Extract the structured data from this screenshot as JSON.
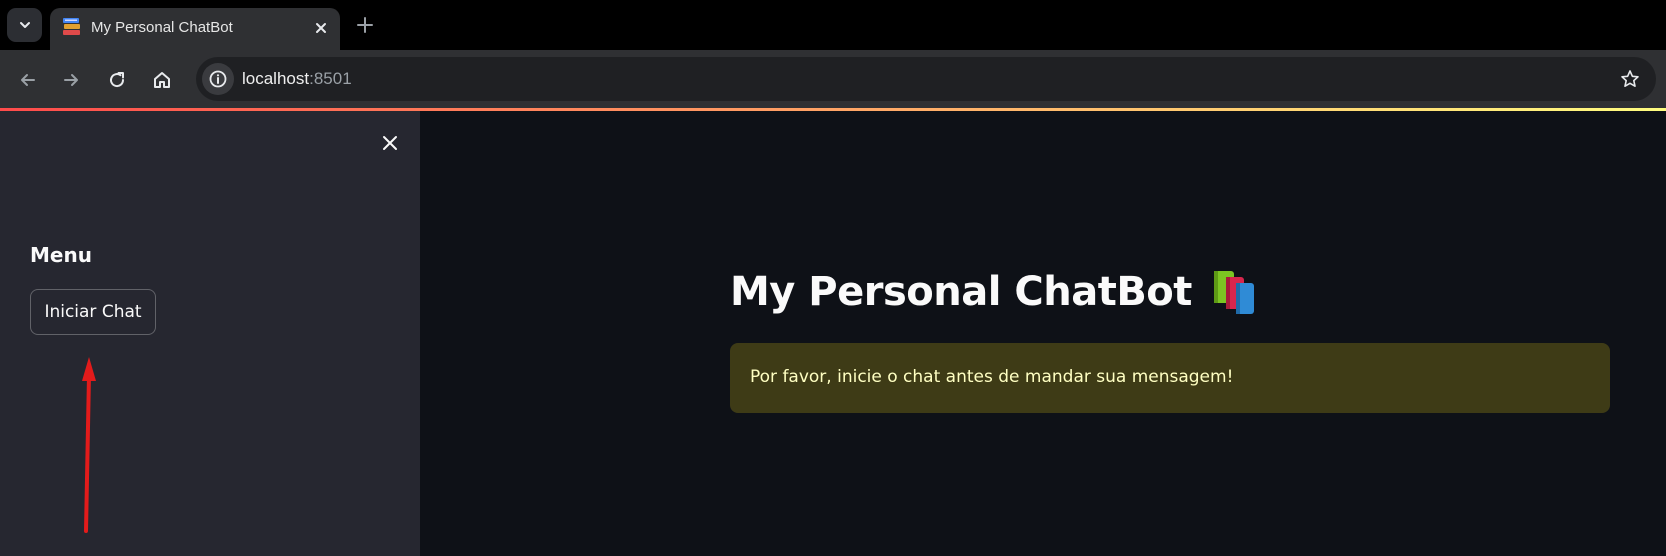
{
  "browser": {
    "tab_title": "My Personal ChatBot",
    "url_host": "localhost",
    "url_port": ":8501",
    "icons": {
      "tab_search": "chevron-down-icon",
      "favicon": "books-icon",
      "tab_close": "close-icon",
      "new_tab": "plus-icon",
      "back": "arrow-left-icon",
      "forward": "arrow-right-icon",
      "reload": "reload-icon",
      "home": "home-icon",
      "site_info": "info-icon",
      "bookmark": "star-icon"
    }
  },
  "sidebar": {
    "heading": "Menu",
    "start_button_label": "Iniciar Chat",
    "close_icon": "close-icon",
    "annotation": "red-arrow"
  },
  "main": {
    "title": "My Personal ChatBot",
    "title_icon": "books-emoji",
    "alert_message": "Por favor, inicie o chat antes de mandar sua mensagem!"
  },
  "colors": {
    "background": "#0e1117",
    "sidebar_background": "#262730",
    "text": "#fafafa",
    "alert_background": "#3e3b16",
    "alert_text": "#ffffc2",
    "accent_gradient_start": "#ff4b4b",
    "accent_gradient_end": "#fffd80",
    "annotation": "#e31b1b"
  }
}
